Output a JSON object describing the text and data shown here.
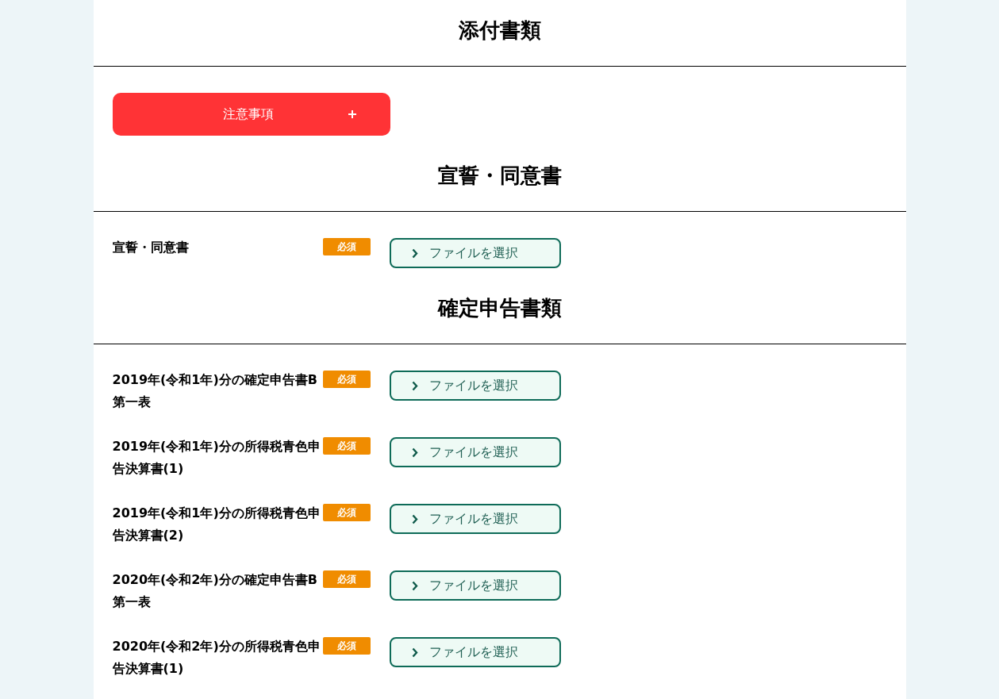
{
  "title": "添付書類",
  "notice": {
    "label": "注意事項",
    "expanded": false
  },
  "sections": [
    {
      "heading": "宣誓・同意書",
      "documents": [
        {
          "label": "宣誓・同意書",
          "required": true,
          "badge": "必須",
          "button": "ファイルを選択"
        }
      ]
    },
    {
      "heading": "確定申告書類",
      "documents": [
        {
          "label": "2019年(令和1年)分の確定申告書B第一表",
          "required": true,
          "badge": "必須",
          "button": "ファイルを選択"
        },
        {
          "label": "2019年(令和1年)分の所得税青色申告決算書(1)",
          "required": true,
          "badge": "必須",
          "button": "ファイルを選択"
        },
        {
          "label": "2019年(令和1年)分の所得税青色申告決算書(2)",
          "required": true,
          "badge": "必須",
          "button": "ファイルを選択"
        },
        {
          "label": "2020年(令和2年)分の確定申告書B第一表",
          "required": true,
          "badge": "必須",
          "button": "ファイルを選択"
        },
        {
          "label": "2020年(令和2年)分の所得税青色申告決算書(1)",
          "required": true,
          "badge": "必須",
          "button": "ファイルを選択"
        }
      ]
    }
  ]
}
